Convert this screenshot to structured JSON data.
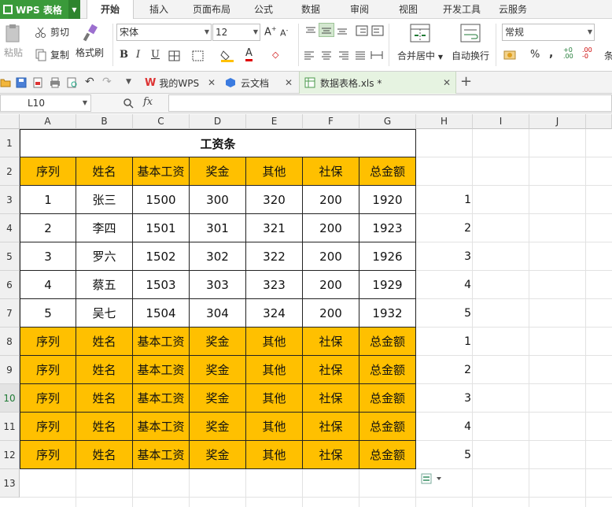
{
  "app": {
    "title": "WPS 表格"
  },
  "menu_tabs": [
    {
      "label": "开始",
      "active": true
    },
    {
      "label": "插入"
    },
    {
      "label": "页面布局"
    },
    {
      "label": "公式"
    },
    {
      "label": "数据"
    },
    {
      "label": "审阅"
    },
    {
      "label": "视图"
    },
    {
      "label": "开发工具"
    },
    {
      "label": "云服务"
    }
  ],
  "ribbon": {
    "paste": "粘贴",
    "cut": "剪切",
    "copy": "复制",
    "format_painter": "格式刷",
    "font_name": "宋体",
    "font_size": "12",
    "merge_center": "合并居中",
    "wrap_text": "自动换行",
    "number_format": "常规",
    "percent": "%",
    "comma": ","
  },
  "doc_tabs": [
    {
      "label": "我的WPS"
    },
    {
      "label": "云文档"
    },
    {
      "label": "数据表格.xls *",
      "active": true
    }
  ],
  "formula_bar": {
    "cell_ref": "L10",
    "fx": "fx",
    "formula": ""
  },
  "columns": [
    "A",
    "B",
    "C",
    "D",
    "E",
    "F",
    "G",
    "H",
    "I",
    "J"
  ],
  "rows": [
    "1",
    "2",
    "3",
    "4",
    "5",
    "6",
    "7",
    "8",
    "9",
    "10",
    "11",
    "12",
    "13"
  ],
  "sheet": {
    "title": "工资条",
    "headers": [
      "序列",
      "姓名",
      "基本工资",
      "奖金",
      "其他",
      "社保",
      "总金额"
    ],
    "data_rows": [
      [
        "1",
        "张三",
        "1500",
        "300",
        "320",
        "200",
        "1920"
      ],
      [
        "2",
        "李四",
        "1501",
        "301",
        "321",
        "200",
        "1923"
      ],
      [
        "3",
        "罗六",
        "1502",
        "302",
        "322",
        "200",
        "1926"
      ],
      [
        "4",
        "蔡五",
        "1503",
        "303",
        "323",
        "200",
        "1929"
      ],
      [
        "5",
        "吴七",
        "1504",
        "304",
        "324",
        "200",
        "1932"
      ]
    ],
    "h_column": [
      "1",
      "2",
      "3",
      "4",
      "5",
      "1",
      "2",
      "3",
      "4",
      "5"
    ]
  },
  "colors": {
    "header_fill": "#ffc000",
    "app_green": "#3a9a3a"
  }
}
